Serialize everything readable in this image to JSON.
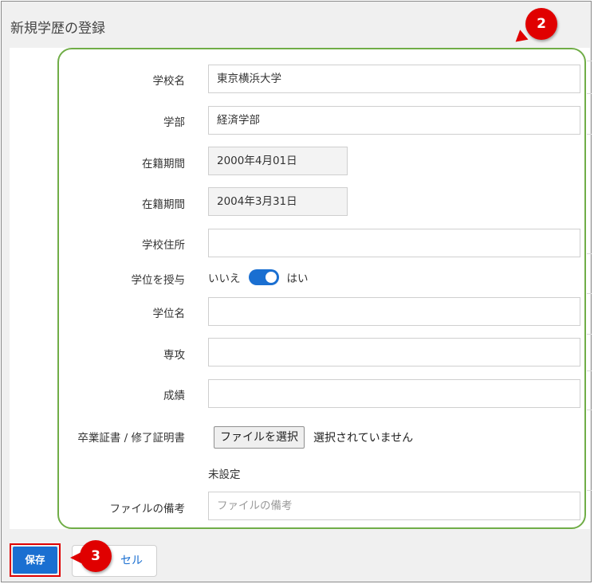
{
  "dialog": {
    "title": "新規学歴の登録"
  },
  "form": {
    "school_name": {
      "label": "学校名",
      "value": "東京横浜大学"
    },
    "faculty": {
      "label": "学部",
      "value": "経済学部"
    },
    "enrollment_start": {
      "label": "在籍期間",
      "value": "2000年4月01日"
    },
    "enrollment_end": {
      "label": "在籍期間",
      "value": "2004年3月31日"
    },
    "school_address": {
      "label": "学校住所",
      "value": ""
    },
    "degree_awarded": {
      "label": "学位を授与",
      "off_label": "いいえ",
      "on_label": "はい",
      "state": "on"
    },
    "degree_name": {
      "label": "学位名",
      "value": ""
    },
    "major": {
      "label": "専攻",
      "value": ""
    },
    "grades": {
      "label": "成績",
      "value": ""
    },
    "certificate": {
      "label": "卒業証書 / 修了証明書",
      "button_label": "ファイルを選択",
      "status": "選択されていません",
      "current_file": "未設定"
    },
    "file_note": {
      "label": "ファイルの備考",
      "placeholder": "ファイルの備考"
    }
  },
  "footer": {
    "save_label": "保存",
    "cancel_label": "セル"
  },
  "annotations": {
    "step2": "2",
    "step3": "3"
  },
  "colors": {
    "accent": "#1a6fd1",
    "annotation_red": "#e00000",
    "highlight_green": "#70ad47"
  }
}
